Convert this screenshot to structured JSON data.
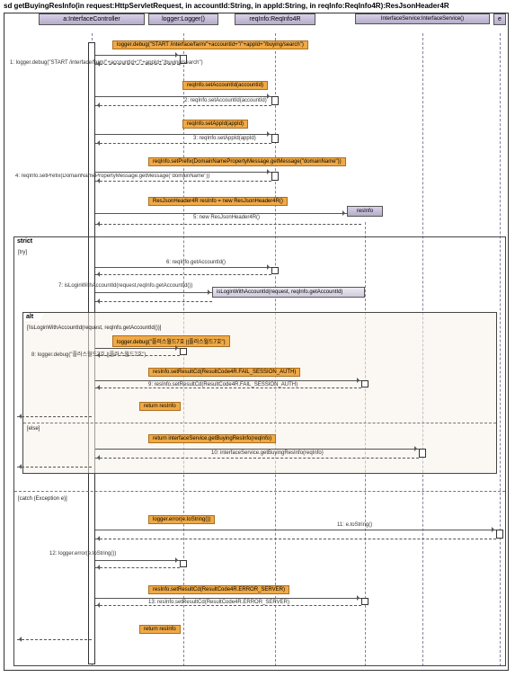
{
  "title": "sd getBuyingResInfo(in request:HttpServletRequest, in accountId:String, in appId:String, in reqInfo:ReqInfo4R):ResJsonHeader4R",
  "lifelines": {
    "controller": "a:InterfaceController",
    "logger": "logger:Logger()",
    "reqInfo": "reqInfo:ReqInfo4R",
    "service": "InterfaceService:InterfaceService()",
    "e": "e"
  },
  "inline_object": "resInfo",
  "messages": {
    "m1_box": "logger.debug(\"START /interface/farm/\"+accountId+\"/\"+appId+\"/buying/search\")",
    "m1_num": "1: logger.debug(\"START /interface/farm/\"+accountId+\"/\"+appId+\"/buying/search\")",
    "m2_box": "reqInfo.setAccountId(accountId)",
    "m2_num": "2: reqInfo.setAccountId(accountId)",
    "m3_box": "reqInfo.setAppId(appId)",
    "m3_num": "3: reqInfo.setAppId(appId)",
    "m4_box": "reqInfo.setPrefix(DomainNamePropertyMessage.getMessage(\"domainName\"))",
    "m4_num": "4: reqInfo.setPrefix(DomainNamePropertyMessage.getMessage(\"domainName\"))",
    "m5_box": "ResJsonHeader4R resInfo = new ResJsonHeader4R()",
    "m5_num": "5: new ResJsonHeader4R()",
    "m6_num": "6: reqInfo.getAccountId()",
    "m7_num": "7: isLoginWithAccountId(request,reqInfo.getAccountId())",
    "m7_ref": "isLoginWithAccountId(request, reqInfo.getAccountId)",
    "m8_box": "logger.debug(\"플러스월드7호 ||플러스월드7호\")",
    "m8_num": "8: logger.debug(\"플러스월드7호 ||플러스월드7호\")",
    "m9_box": "resInfo.setResultCd(ResultCode4R.FAIL_SESSION_AUTH)",
    "m9_num": "9: resInfo.setResultCd(ResultCode4R.FAIL_SESSION_AUTH)",
    "m_ret1": "return resInfo",
    "m10_box": "return interfaceService.getBuyingResInfo(reqInfo)",
    "m10_num": "10: interfaceService.getBuyingResInfo(reqInfo)",
    "m11_box": "logger.error(e.toString())",
    "m11_num": "11: e.toString()",
    "m12_num": "12: logger.error(e.toString())",
    "m13_box": "resInfo.setResultCd(ResultCode4R.ERROR_SERVER)",
    "m13_num": "13: resInfo.setResultCd(ResultCode4R.ERROR_SERVER)",
    "m_ret2": "return resInfo"
  },
  "fragments": {
    "try_label": "strict",
    "try_guard": "[try]",
    "alt_label": "alt",
    "alt_guard": "[!isLoginWithAccountId(request, reqInfo.getAccountId())]",
    "else_guard": "[else]",
    "catch_guard": "[catch (Exception e)]"
  }
}
